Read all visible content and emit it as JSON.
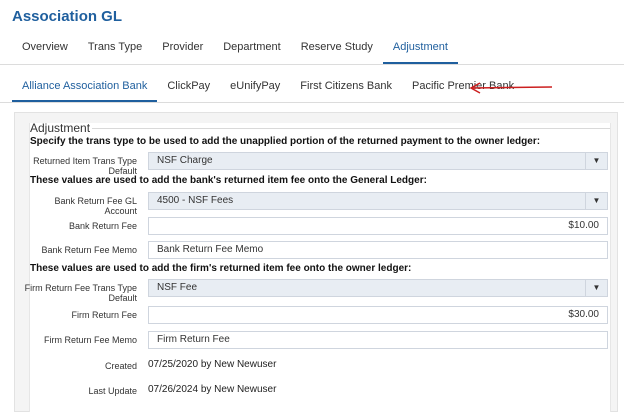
{
  "app": {
    "title": "Association GL"
  },
  "primary_tabs": [
    {
      "label": "Overview",
      "active": false
    },
    {
      "label": "Trans Type",
      "active": false
    },
    {
      "label": "Provider",
      "active": false
    },
    {
      "label": "Department",
      "active": false
    },
    {
      "label": "Reserve Study",
      "active": false
    },
    {
      "label": "Adjustment",
      "active": true
    }
  ],
  "secondary_tabs": [
    {
      "label": "Alliance Association Bank",
      "active": true
    },
    {
      "label": "ClickPay",
      "active": false
    },
    {
      "label": "eUnifyPay",
      "active": false
    },
    {
      "label": "First Citizens Bank",
      "active": false
    },
    {
      "label": "Pacific Premier Bank",
      "active": false
    }
  ],
  "annotation": {
    "arrow_color": "#cc1f1f"
  },
  "adjustment": {
    "legend": "Adjustment",
    "instruction_1": "Specify the trans type to be used to add the unapplied portion of the returned payment to the owner ledger:",
    "returned_item_label": "Returned Item Trans Type Default",
    "returned_item_value": "NSF Charge",
    "instruction_2": "These values are used to add the bank's returned item fee onto the General Ledger:",
    "bank_gl_label": "Bank Return Fee GL Account",
    "bank_gl_value": "4500 - NSF Fees",
    "bank_fee_label": "Bank Return Fee",
    "bank_fee_value": "$10.00",
    "bank_memo_label": "Bank Return Fee Memo",
    "bank_memo_value": "Bank Return Fee Memo",
    "instruction_3": "These values are used to add the firm's returned item fee onto the owner ledger:",
    "firm_trans_label": "Firm Return Fee Trans Type Default",
    "firm_trans_value": "NSF Fee",
    "firm_fee_label": "Firm Return Fee",
    "firm_fee_value": "$30.00",
    "firm_memo_label": "Firm Return Fee Memo",
    "firm_memo_value": "Firm Return Fee",
    "created_label": "Created",
    "created_value": "07/25/2020 by New Newuser",
    "updated_label": "Last Update",
    "updated_value": "07/26/2024 by New Newuser"
  },
  "icons": {
    "dropdown": "chevron-down-icon",
    "caret_glyph": "▼"
  }
}
